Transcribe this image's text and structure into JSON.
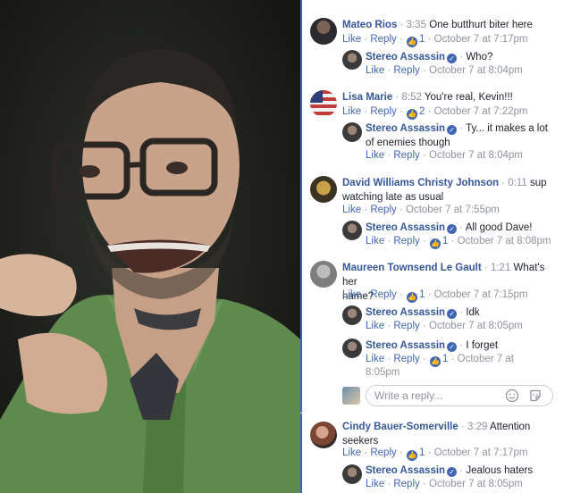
{
  "comments": [
    {
      "author": "Mateo Rios",
      "video_time": "3:35",
      "text": "One butthurt biter here",
      "like_label": "Like",
      "reply_label": "Reply",
      "like_count": "1",
      "date": "October 7 at 7:17pm",
      "replies": [
        {
          "author": "Stereo Assassin",
          "text": "Who?",
          "like_label": "Like",
          "reply_label": "Reply",
          "date": "October 7 at 8:04pm"
        }
      ]
    },
    {
      "author": "Lisa Marie",
      "video_time": "8:52",
      "text": "You're real, Kevin!!!",
      "like_label": "Like",
      "reply_label": "Reply",
      "like_count": "2",
      "date": "October 7 at 7:22pm",
      "replies": [
        {
          "author": "Stereo Assassin",
          "text_line1": "Ty... it makes a lot",
          "text_line2": "of enemies though",
          "like_label": "Like",
          "reply_label": "Reply",
          "date": "October 7 at 8:04pm"
        }
      ]
    },
    {
      "author": "David Williams Christy Johnson",
      "video_time": "0:11",
      "text_line1": "sup",
      "text_line2": "watching late as usual",
      "like_label": "Like",
      "reply_label": "Reply",
      "date": "October 7 at 7:55pm",
      "replies": [
        {
          "author": "Stereo Assassin",
          "text": "All good Dave!",
          "like_label": "Like",
          "reply_label": "Reply",
          "like_count": "1",
          "date": "October 7 at 8:08pm"
        }
      ]
    },
    {
      "author": "Maureen Townsend Le Gault",
      "video_time": "1:21",
      "text_line1": "What's her",
      "text_line2": "name?",
      "like_label": "Like",
      "reply_label": "Reply",
      "like_count": "1",
      "date": "October 7 at 7:15pm",
      "replies": [
        {
          "author": "Stereo Assassin",
          "text": "Idk",
          "like_label": "Like",
          "reply_label": "Reply",
          "date": "October 7 at 8:05pm"
        },
        {
          "author": "Stereo Assassin",
          "text": "I forget",
          "like_label": "Like",
          "reply_label": "Reply",
          "like_count": "1",
          "date_line1": "October 7 at",
          "date_line2": "8:05pm"
        }
      ]
    },
    {
      "author": "Cindy Bauer-Somerville",
      "video_time": "3:29",
      "text_line1": "Attention",
      "text_line2": "seekers",
      "like_label": "Like",
      "reply_label": "Reply",
      "like_count": "1",
      "date": "October 7 at 7:17pm",
      "replies": [
        {
          "author": "Stereo Assassin",
          "text": "Jealous haters",
          "like_label": "Like",
          "reply_label": "Reply",
          "date": "October 7 at 8:05pm"
        }
      ]
    }
  ],
  "reply_box": {
    "placeholder": "Write a reply..."
  },
  "colors": {
    "link": "#4267b2",
    "name": "#365899",
    "meta": "#90949c",
    "accent": "#4267b2"
  },
  "icons": [
    "verified-badge-icon",
    "like-thumb-icon",
    "emoji-icon",
    "sticker-icon"
  ]
}
